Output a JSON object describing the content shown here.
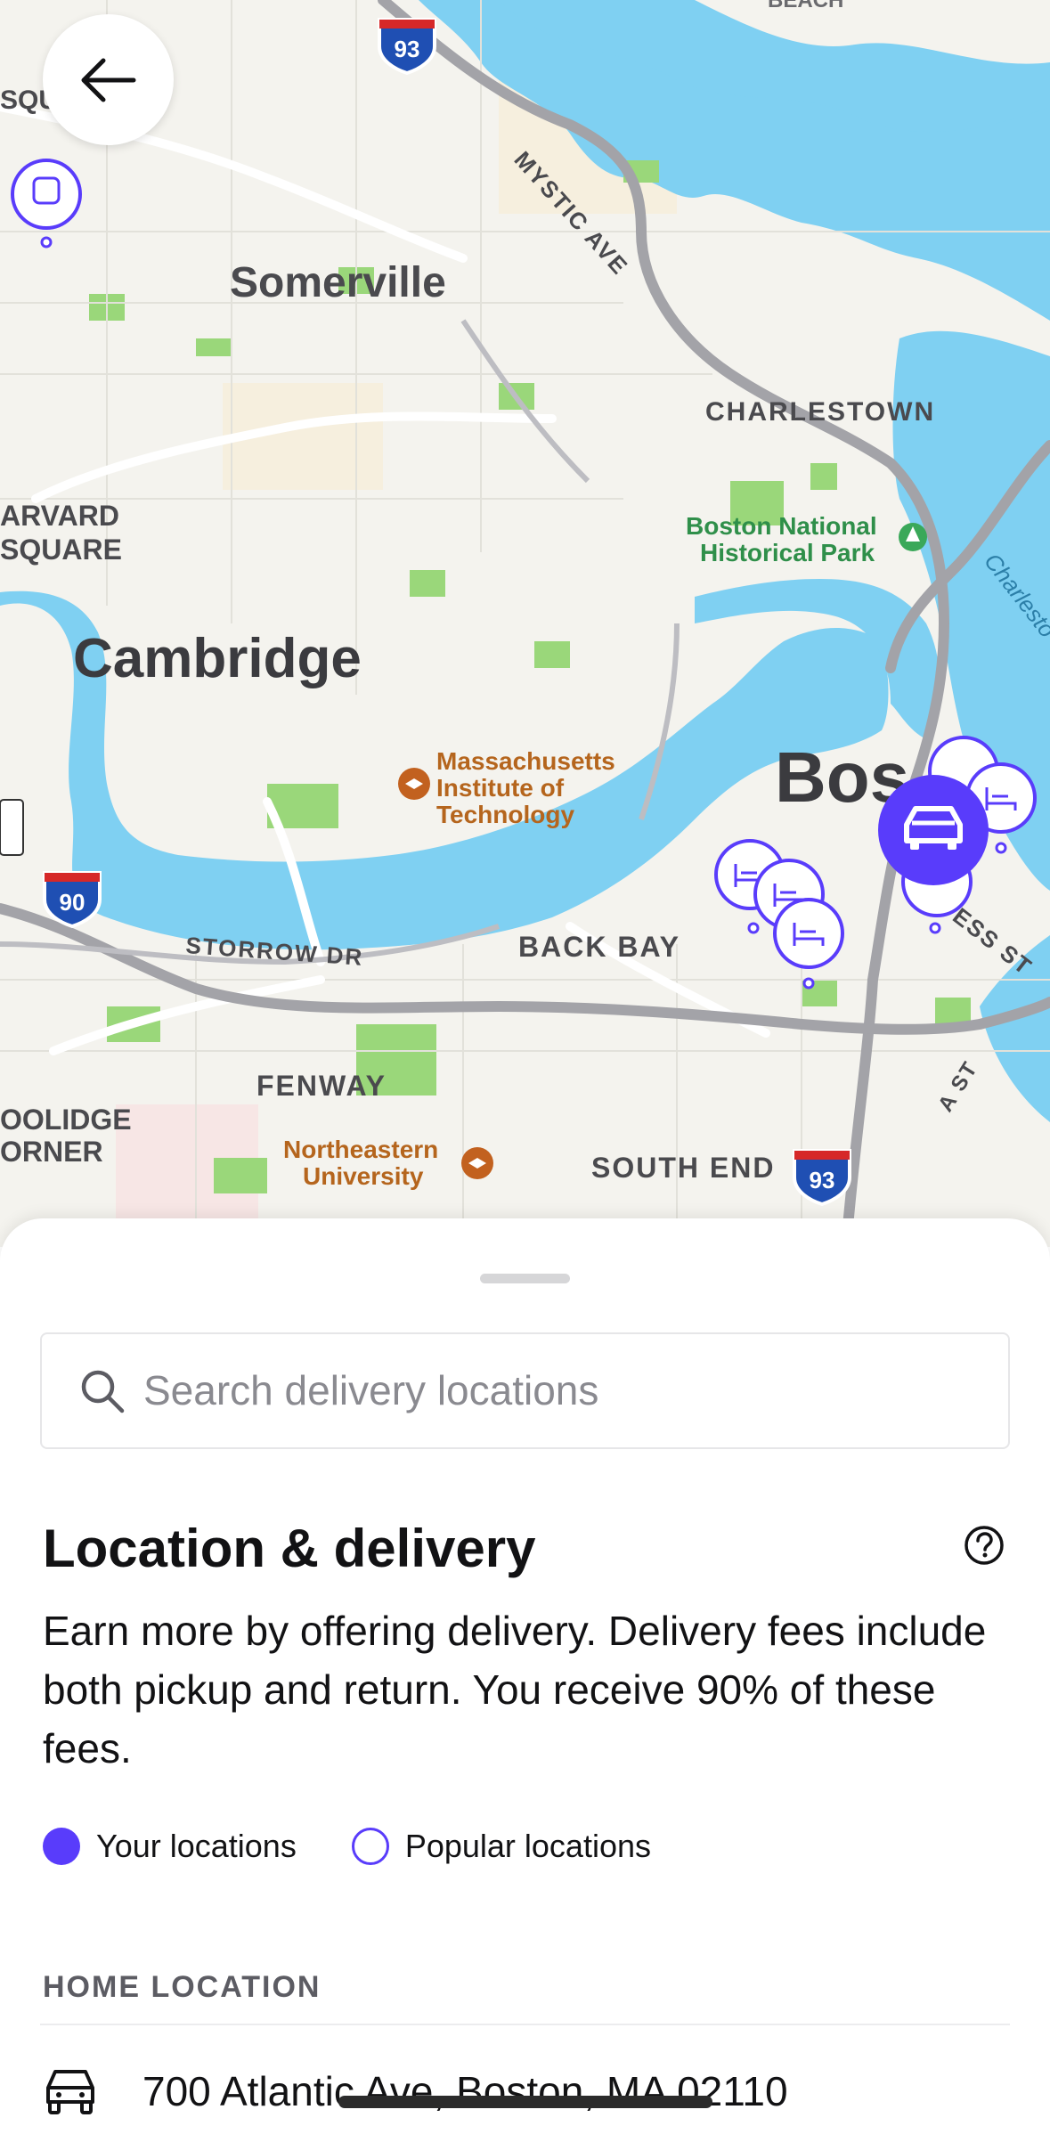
{
  "map": {
    "labels": {
      "somerville": "Somerville",
      "cambridge": "Cambridge",
      "charlestown": "CHARLESTOWN",
      "boston": "Bos",
      "back_bay": "BACK BAY",
      "fenway": "FENWAY",
      "south_end": "SOUTH END",
      "harvard_1": "ARVARD",
      "harvard_2": "SQUARE",
      "coolidge_1": "OOLIDGE",
      "coolidge_2": "ORNER",
      "squ": "SQU",
      "mystic_ave": "MYSTIC AVE",
      "storrow_dr": "STORROW DR",
      "ess_st": "ESS ST",
      "a_st": "A ST",
      "charlesto": "Charlesto",
      "boston_national_1": "Boston National",
      "boston_national_2": "Historical Park",
      "mit_1": "Massachusetts",
      "mit_2": "Institute of",
      "mit_3": "Technology",
      "northeastern_1": "Northeastern",
      "northeastern_2": "University",
      "beach": "BEACH"
    },
    "highways": {
      "i93_top": "93",
      "i90": "90",
      "i93_bottom": "93"
    },
    "colors": {
      "water": "#7fd0f2",
      "land": "#f4f3ee",
      "park": "#9ad77a",
      "road": "#9a9aa0",
      "accent": "#593cfb"
    }
  },
  "back_button": {
    "icon": "arrow-left-icon"
  },
  "search": {
    "placeholder": "Search delivery locations",
    "icon": "search-icon"
  },
  "section": {
    "title": "Location & delivery",
    "description": "Earn more by offering delivery. Delivery fees include both pickup and return. You receive 90% of these fees.",
    "help_icon": "question-circle-icon"
  },
  "legend": {
    "yours": "Your locations",
    "popular": "Popular locations"
  },
  "home": {
    "label": "HOME LOCATION",
    "address": "700 Atlantic Ave, Boston, MA 02110",
    "icon": "car-icon"
  }
}
